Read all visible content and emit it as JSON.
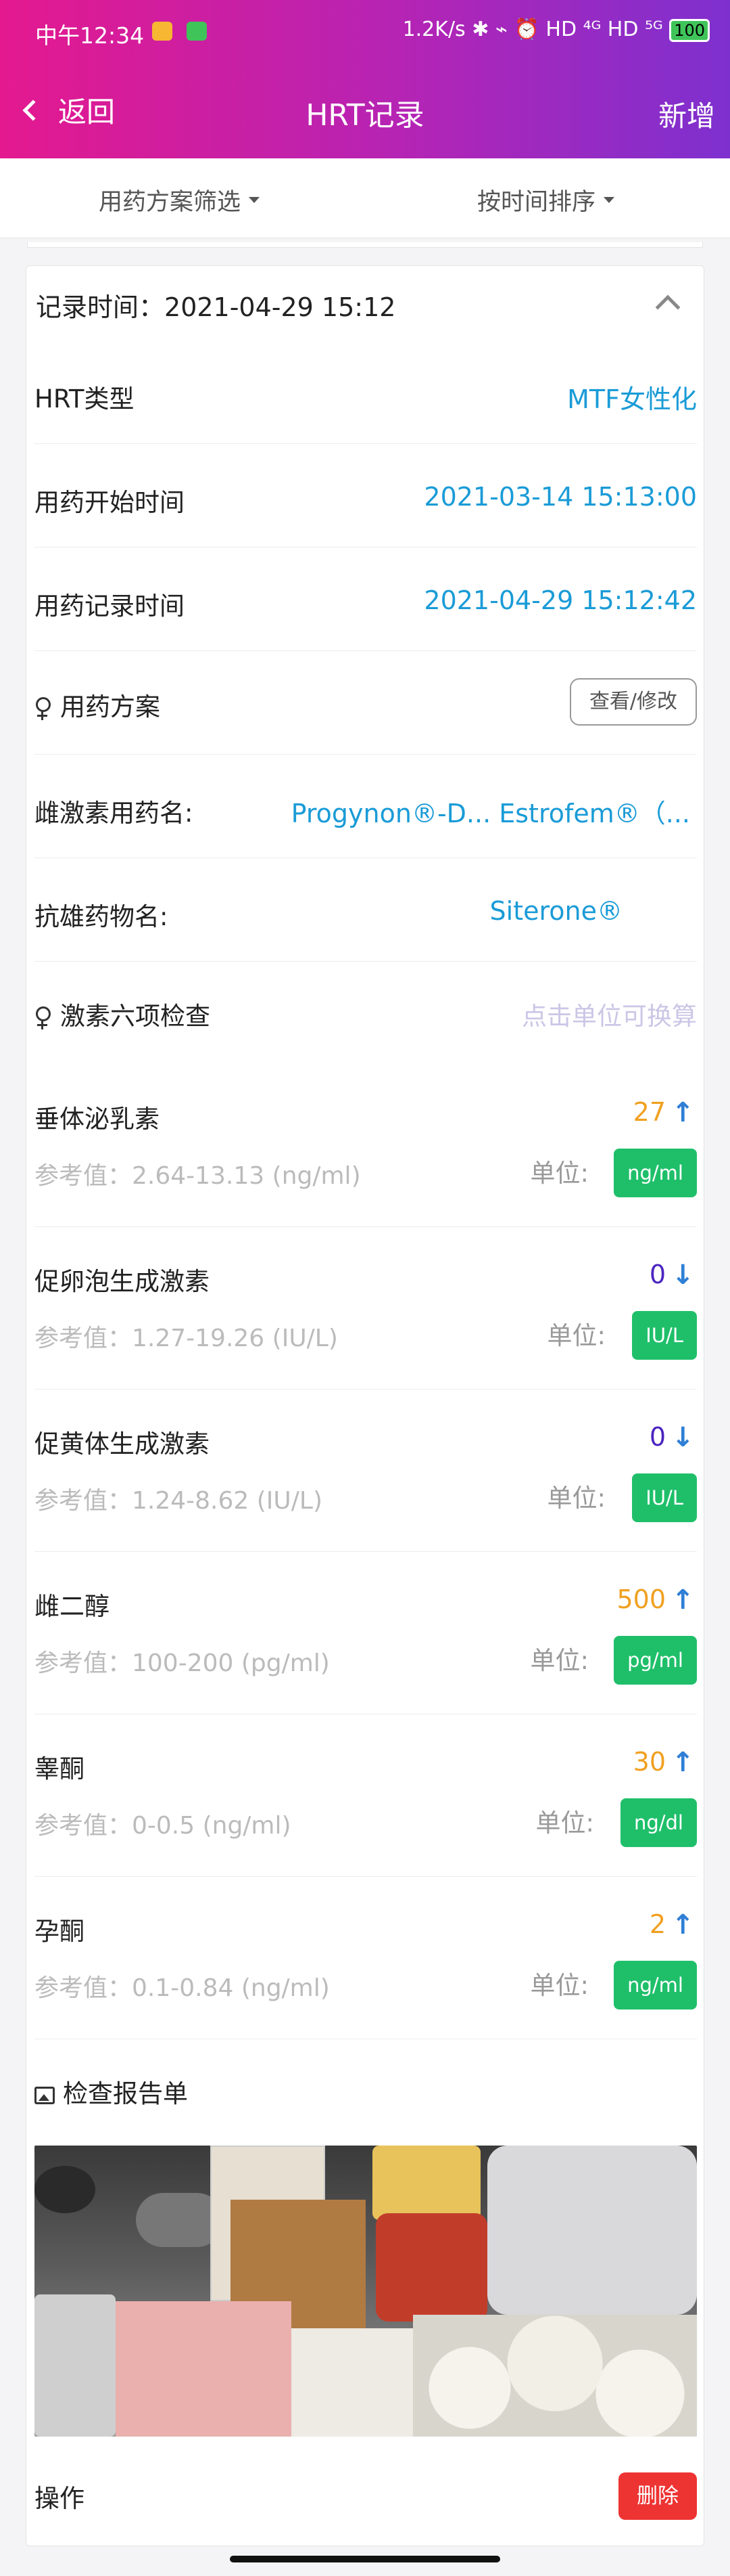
{
  "status_bar": {
    "time": "中午12:34",
    "right": "1.2K/s ✱ ⌁ ⏰ HD ⁴ᴳ HD ⁵ᴳ",
    "battery": "100"
  },
  "nav": {
    "back_label": "返回",
    "title": "HRT记录",
    "add_label": "新增"
  },
  "filters": {
    "plan": "用药方案筛选",
    "sort": "按时间排序"
  },
  "record": {
    "time_label": "记录时间：",
    "time_value": "2021-04-29 15:12",
    "hrt_type_label": "HRT类型",
    "hrt_type_value": "MTF女性化",
    "start_label": "用药开始时间",
    "start_value": "2021-03-14 15:13:00",
    "record_label": "用药记录时间",
    "record_value": "2021-04-29 15:12:42",
    "plan_label": "用药方案",
    "plan_button": "查看/修改",
    "estrogen_label": "雌激素用药名:",
    "estrogen_value": "Progynon®-D...  Estrofem®（...",
    "antiandrogen_label": "抗雄药物名:",
    "antiandrogen_value": "Siterone®",
    "hormone_label": "激素六项检查",
    "hormone_hint": "点击单位可换算",
    "report_label": "检查报告单",
    "op_label": "操作",
    "delete_label": "删除"
  },
  "hormones": [
    {
      "name": "垂体泌乳素",
      "value": "27",
      "trend": "↑",
      "ref": "参考值：2.64-13.13 (ng/ml)",
      "unit_label": "单位:",
      "unit": "ng/ml"
    },
    {
      "name": "促卵泡生成激素",
      "value": "0",
      "trend": "↓",
      "ref": "参考值：1.27-19.26 (IU/L)",
      "unit_label": "单位:",
      "unit": "IU/L"
    },
    {
      "name": "促黄体生成激素",
      "value": "0",
      "trend": "↓",
      "ref": "参考值：1.24-8.62 (IU/L)",
      "unit_label": "单位:",
      "unit": "IU/L"
    },
    {
      "name": "雌二醇",
      "value": "500",
      "trend": "↑",
      "ref": "参考值：100-200 (pg/ml)",
      "unit_label": "单位:",
      "unit": "pg/ml"
    },
    {
      "name": "睾酮",
      "value": "30",
      "trend": "↑",
      "ref": "参考值：0-0.5 (ng/ml)",
      "unit_label": "单位:",
      "unit": "ng/dl"
    },
    {
      "name": "孕酮",
      "value": "2",
      "trend": "↑",
      "ref": "参考值：0.1-0.84 (ng/ml)",
      "unit_label": "单位:",
      "unit": "ng/ml"
    }
  ]
}
